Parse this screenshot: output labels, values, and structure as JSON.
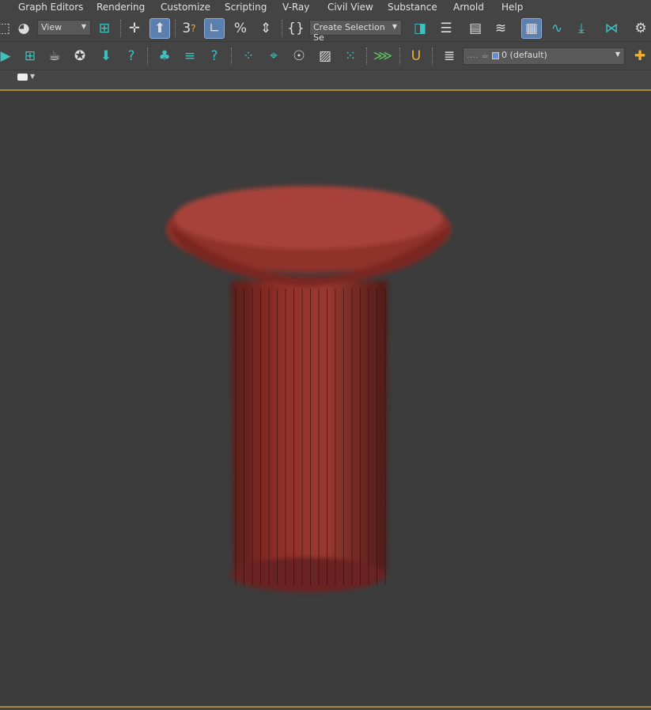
{
  "menubar": {
    "items": [
      "Graph Editors",
      "Rendering",
      "Customize",
      "Scripting",
      "V-Ray",
      "Civil View",
      "Substance",
      "Arnold",
      "Help"
    ]
  },
  "toolbar": {
    "view_dropdown": "View",
    "selection_set_dropdown": "Create Selection Se",
    "layer_dropdown": "0 (default)",
    "snap_label": "3"
  },
  "colors": {
    "accent": "#5b7fae",
    "viewport_bg": "#3c3c3c",
    "object": "#8a2a24",
    "viewport_border": "#a88a3a"
  }
}
